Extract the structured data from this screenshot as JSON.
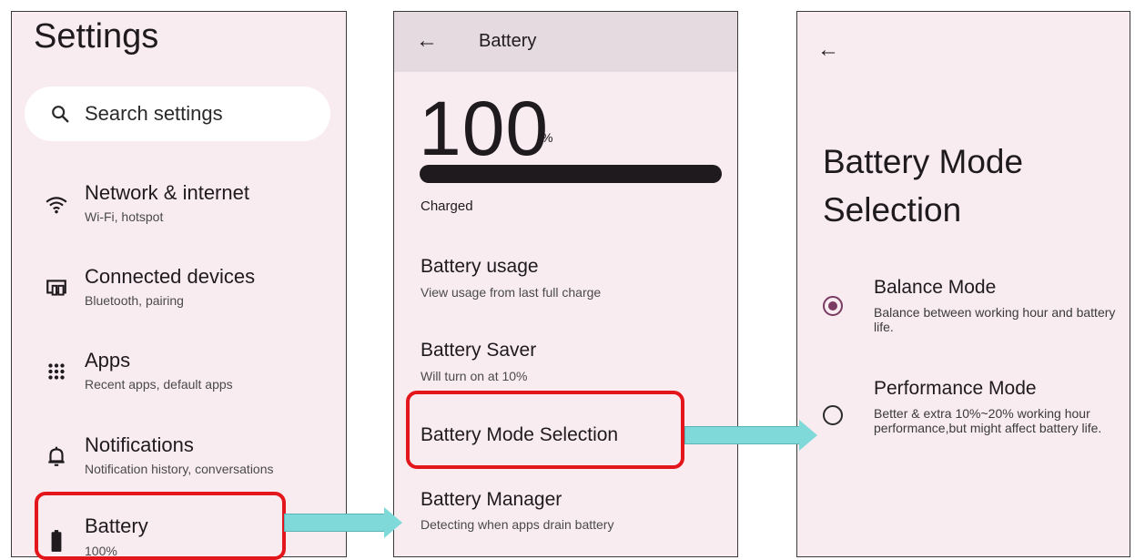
{
  "settings": {
    "title": "Settings",
    "search_placeholder": "Search settings",
    "items": [
      {
        "title": "Network & internet",
        "subtitle": "Wi-Fi, hotspot",
        "icon": "wifi-icon"
      },
      {
        "title": "Connected devices",
        "subtitle": "Bluetooth, pairing",
        "icon": "devices-icon"
      },
      {
        "title": "Apps",
        "subtitle": "Recent apps, default apps",
        "icon": "apps-grid-icon"
      },
      {
        "title": "Notifications",
        "subtitle": "Notification history, conversations",
        "icon": "bell-icon"
      },
      {
        "title": "Battery",
        "subtitle": "100%",
        "icon": "battery-icon"
      }
    ]
  },
  "battery": {
    "header_title": "Battery",
    "level": "100",
    "level_unit": "%",
    "level_fraction": 1.0,
    "status": "Charged",
    "items": [
      {
        "title": "Battery usage",
        "subtitle": "View usage from last full charge"
      },
      {
        "title": "Battery Saver",
        "subtitle": "Will turn on at 10%"
      },
      {
        "title": "Battery Mode Selection",
        "subtitle": ""
      },
      {
        "title": "Battery Manager",
        "subtitle": "Detecting when apps drain battery"
      }
    ]
  },
  "mode_selection": {
    "title": "Battery Mode Selection",
    "modes": [
      {
        "title": "Balance Mode",
        "description": "Balance between working hour and battery life.",
        "selected": true
      },
      {
        "title": "Performance Mode",
        "description": "Better & extra 10%~20% working hour performance,but might affect battery life.",
        "selected": false
      }
    ]
  },
  "colors": {
    "panel_bg": "#f8ecf1",
    "highlight": "#e3161b",
    "arrow": "#7fd9d9",
    "radio_accent": "#7a3a62"
  }
}
